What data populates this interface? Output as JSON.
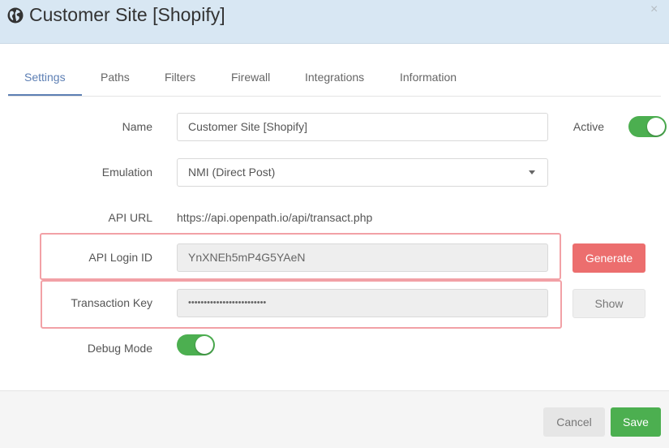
{
  "header": {
    "title": "Customer Site [Shopify]",
    "close_glyph": "×"
  },
  "tabs": [
    {
      "label": "Settings",
      "active": true
    },
    {
      "label": "Paths"
    },
    {
      "label": "Filters"
    },
    {
      "label": "Firewall"
    },
    {
      "label": "Integrations"
    },
    {
      "label": "Information"
    }
  ],
  "form": {
    "name_label": "Name",
    "name_value": "Customer Site [Shopify]",
    "active_label": "Active",
    "active_on": true,
    "emulation_label": "Emulation",
    "emulation_value": "NMI (Direct Post)",
    "api_url_label": "API URL",
    "api_url_value": "https://api.openpath.io/api/transact.php",
    "api_login_label": "API Login ID",
    "api_login_value": "YnXNEh5mP4G5YAeN",
    "generate_label": "Generate",
    "transaction_key_label": "Transaction Key",
    "transaction_key_value": "•••••••••••••••••••••••••",
    "show_label": "Show",
    "debug_label": "Debug Mode",
    "debug_on": true
  },
  "footer": {
    "cancel_label": "Cancel",
    "save_label": "Save"
  },
  "colors": {
    "accent": "#5d7fb4",
    "toggle_on": "#4caf50",
    "generate": "#ec6e6e",
    "save": "#4caf50",
    "header_bg": "#d8e7f3",
    "highlight": "#e8545c"
  }
}
